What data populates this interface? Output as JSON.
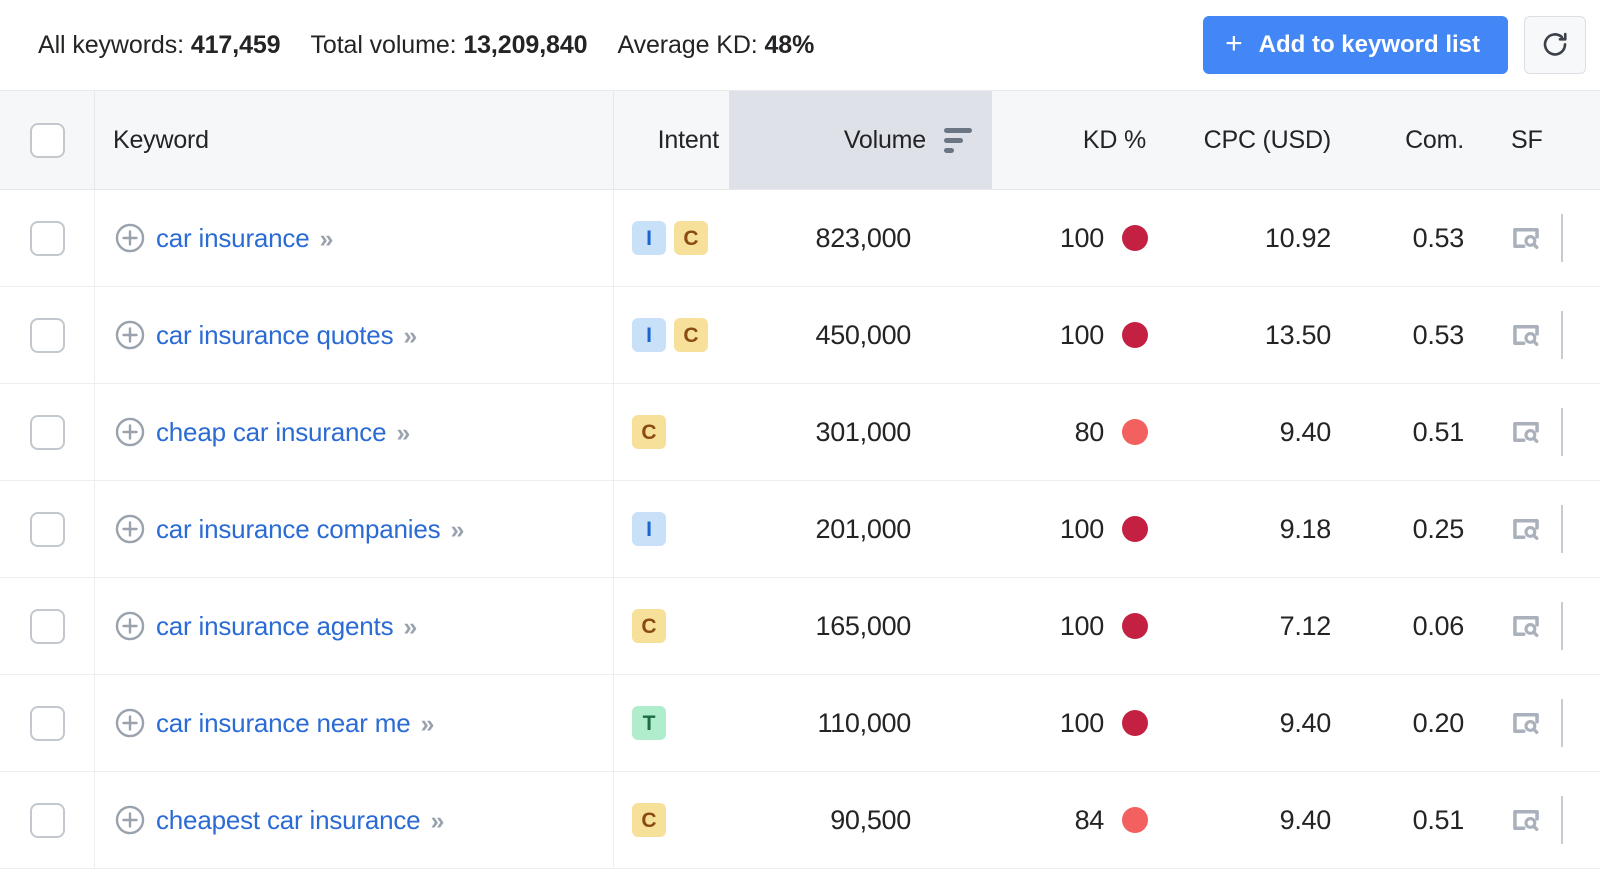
{
  "summary": {
    "stats": [
      {
        "label": "All keywords: ",
        "value": "417,459"
      },
      {
        "label": "Total volume: ",
        "value": "13,209,840"
      },
      {
        "label": "Average KD: ",
        "value": "48%"
      }
    ]
  },
  "actions": {
    "add_to_list_label": "Add to keyword list",
    "add_plus_glyph": "+",
    "refresh_icon": "refresh-icon",
    "accent_color": "#4287f5"
  },
  "table": {
    "columns": {
      "keyword": "Keyword",
      "intent": "Intent",
      "volume": "Volume",
      "kd": "KD %",
      "cpc": "CPC (USD)",
      "com": "Com.",
      "sf": "SF"
    },
    "sorted_by": "Volume",
    "sort_direction": "descending",
    "select_all_checked": false,
    "rows": [
      {
        "keyword": "car insurance",
        "intent": [
          "I",
          "C"
        ],
        "volume": "823,000",
        "kd": "100",
        "kd_color": "#c42142",
        "cpc": "10.92",
        "com": "0.53",
        "sf_icon": "serp-preview-icon",
        "checked": false
      },
      {
        "keyword": "car insurance quotes",
        "intent": [
          "I",
          "C"
        ],
        "volume": "450,000",
        "kd": "100",
        "kd_color": "#c42142",
        "cpc": "13.50",
        "com": "0.53",
        "sf_icon": "serp-preview-icon",
        "checked": false
      },
      {
        "keyword": "cheap car insurance",
        "intent": [
          "C"
        ],
        "volume": "301,000",
        "kd": "80",
        "kd_color": "#f2605f",
        "cpc": "9.40",
        "com": "0.51",
        "sf_icon": "serp-preview-icon",
        "checked": false
      },
      {
        "keyword": "car insurance companies",
        "intent": [
          "I"
        ],
        "volume": "201,000",
        "kd": "100",
        "kd_color": "#c42142",
        "cpc": "9.18",
        "com": "0.25",
        "sf_icon": "serp-preview-icon",
        "checked": false
      },
      {
        "keyword": "car insurance agents",
        "intent": [
          "C"
        ],
        "volume": "165,000",
        "kd": "100",
        "kd_color": "#c42142",
        "cpc": "7.12",
        "com": "0.06",
        "sf_icon": "serp-preview-icon",
        "checked": false
      },
      {
        "keyword": "car insurance near me",
        "intent": [
          "T"
        ],
        "volume": "110,000",
        "kd": "100",
        "kd_color": "#c42142",
        "cpc": "9.40",
        "com": "0.20",
        "sf_icon": "serp-preview-icon",
        "checked": false
      },
      {
        "keyword": "cheapest car insurance",
        "intent": [
          "C"
        ],
        "volume": "90,500",
        "kd": "84",
        "kd_color": "#f2605f",
        "cpc": "9.40",
        "com": "0.51",
        "sf_icon": "serp-preview-icon",
        "checked": false
      }
    ],
    "keyword_expand_glyph": "»"
  }
}
